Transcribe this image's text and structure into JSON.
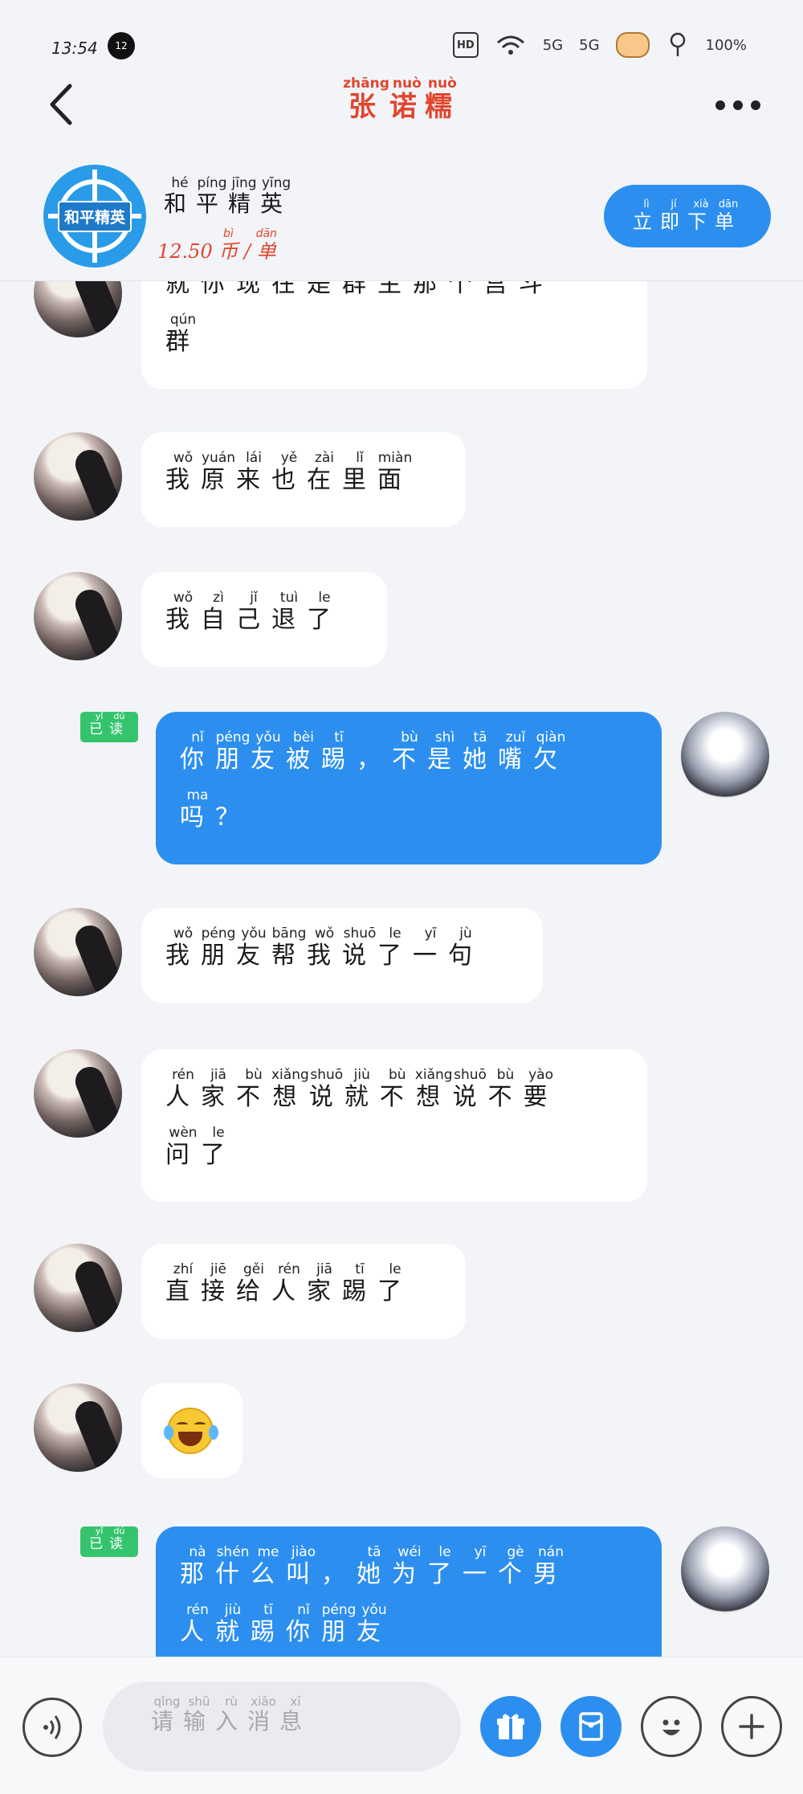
{
  "status_bar": {
    "time": "13:54",
    "notification_count": "12",
    "hd_label": "HD",
    "signal_1": "5G",
    "signal_2": "5G",
    "battery": "100%"
  },
  "header": {
    "title": [
      [
        "张",
        "zhāng"
      ],
      [
        "诺",
        "nuò"
      ],
      [
        "糯",
        "nuò"
      ]
    ],
    "back_icon": "chevron-left-icon",
    "more_icon": "more-horizontal-icon"
  },
  "product": {
    "logo_text": "和平精英",
    "name": [
      [
        "和",
        "hé"
      ],
      [
        "平",
        "píng"
      ],
      [
        "精",
        "jīng"
      ],
      [
        "英",
        "yīng"
      ]
    ],
    "price_prefix": "12.50",
    "price_unit": [
      [
        "币",
        "bì"
      ]
    ],
    "price_sep": "/",
    "price_per": [
      [
        "单",
        "dān"
      ]
    ],
    "order_button": [
      [
        "立",
        "lì"
      ],
      [
        "即",
        "jí"
      ],
      [
        "下",
        "xià"
      ],
      [
        "单",
        "dān"
      ]
    ]
  },
  "messages": [
    {
      "side": "in",
      "lines": [
        [
          [
            "就",
            ""
          ],
          [
            "你",
            ""
          ],
          [
            "现",
            ""
          ],
          [
            "在",
            ""
          ],
          [
            "是",
            ""
          ],
          [
            "群",
            ""
          ],
          [
            "主",
            ""
          ],
          [
            "那",
            ""
          ],
          [
            "个",
            ""
          ],
          [
            "宫",
            ""
          ],
          [
            "斗",
            ""
          ]
        ],
        [
          [
            "群",
            "qún"
          ]
        ]
      ]
    },
    {
      "side": "in",
      "lines": [
        [
          [
            "我",
            "wǒ"
          ],
          [
            "原",
            "yuán"
          ],
          [
            "来",
            "lái"
          ],
          [
            "也",
            "yě"
          ],
          [
            "在",
            "zài"
          ],
          [
            "里",
            "lǐ"
          ],
          [
            "面",
            "miàn"
          ]
        ]
      ]
    },
    {
      "side": "in",
      "lines": [
        [
          [
            "我",
            "wǒ"
          ],
          [
            "自",
            "zì"
          ],
          [
            "己",
            "jǐ"
          ],
          [
            "退",
            "tuì"
          ],
          [
            "了",
            "le"
          ]
        ]
      ]
    },
    {
      "side": "out",
      "read": [
        [
          "已",
          "yǐ"
        ],
        [
          "读",
          "dú"
        ]
      ],
      "lines": [
        [
          [
            "你",
            "nǐ"
          ],
          [
            "朋",
            "péng"
          ],
          [
            "友",
            "yǒu"
          ],
          [
            "被",
            "bèi"
          ],
          [
            "踢",
            "tī"
          ],
          [
            "，",
            ""
          ],
          [
            "不",
            "bù"
          ],
          [
            "是",
            "shì"
          ],
          [
            "她",
            "tā"
          ],
          [
            "嘴",
            "zuǐ"
          ],
          [
            "欠",
            "qiàn"
          ]
        ],
        [
          [
            "吗",
            "ma"
          ],
          [
            "？",
            ""
          ]
        ]
      ]
    },
    {
      "side": "in",
      "lines": [
        [
          [
            "我",
            "wǒ"
          ],
          [
            "朋",
            "péng"
          ],
          [
            "友",
            "yǒu"
          ],
          [
            "帮",
            "bāng"
          ],
          [
            "我",
            "wǒ"
          ],
          [
            "说",
            "shuō"
          ],
          [
            "了",
            "le"
          ],
          [
            "一",
            "yī"
          ],
          [
            "句",
            "jù"
          ]
        ]
      ]
    },
    {
      "side": "in",
      "lines": [
        [
          [
            "人",
            "rén"
          ],
          [
            "家",
            "jiā"
          ],
          [
            "不",
            "bù"
          ],
          [
            "想",
            "xiǎng"
          ],
          [
            "说",
            "shuō"
          ],
          [
            "就",
            "jiù"
          ],
          [
            "不",
            "bù"
          ],
          [
            "想",
            "xiǎng"
          ],
          [
            "说",
            "shuō"
          ],
          [
            "不",
            "bù"
          ],
          [
            "要",
            "yào"
          ]
        ],
        [
          [
            "问",
            "wèn"
          ],
          [
            "了",
            "le"
          ]
        ]
      ]
    },
    {
      "side": "in",
      "lines": [
        [
          [
            "直",
            "zhí"
          ],
          [
            "接",
            "jiē"
          ],
          [
            "给",
            "gěi"
          ],
          [
            "人",
            "rén"
          ],
          [
            "家",
            "jiā"
          ],
          [
            "踢",
            "tī"
          ],
          [
            "了",
            "le"
          ]
        ]
      ]
    },
    {
      "side": "in",
      "emoji": "face-with-tears-of-joy"
    },
    {
      "side": "out",
      "read": [
        [
          "已",
          "yǐ"
        ],
        [
          "读",
          "dú"
        ]
      ],
      "lines": [
        [
          [
            "那",
            "nà"
          ],
          [
            "什",
            "shén"
          ],
          [
            "么",
            "me"
          ],
          [
            "叫",
            "jiào"
          ],
          [
            "，",
            ""
          ],
          [
            "她",
            "tā"
          ],
          [
            "为",
            "wéi"
          ],
          [
            "了",
            "le"
          ],
          [
            "一",
            "yī"
          ],
          [
            "个",
            "gè"
          ],
          [
            "男",
            "nán"
          ]
        ],
        [
          [
            "人",
            "rén"
          ],
          [
            "就",
            "jiù"
          ],
          [
            "踢",
            "tī"
          ],
          [
            "你",
            "nǐ"
          ],
          [
            "朋",
            "péng"
          ],
          [
            "友",
            "yǒu"
          ]
        ]
      ]
    }
  ],
  "input": {
    "placeholder": [
      [
        "请",
        "qǐng"
      ],
      [
        "输",
        "shū"
      ],
      [
        "入",
        "rù"
      ],
      [
        "消",
        "xiāo"
      ],
      [
        "息",
        "xī"
      ]
    ],
    "voice_icon": "voice-icon",
    "gift_icon": "gift-icon",
    "redpacket_icon": "red-packet-icon",
    "emoji_icon": "emoji-icon",
    "plus_icon": "plus-icon"
  },
  "colors": {
    "accent_blue": "#2c8ff0",
    "title_red": "#e0452d",
    "read_green": "#35c46d",
    "bg": "#f2f4f7"
  }
}
